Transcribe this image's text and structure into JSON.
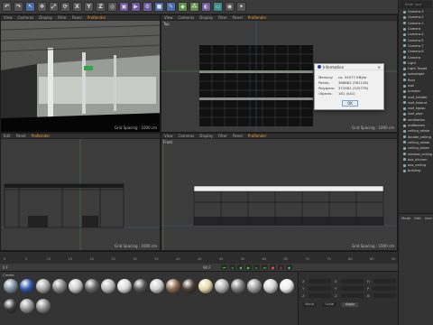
{
  "toolbar": {
    "icons": [
      "undo-icon",
      "redo-icon",
      "select-icon",
      "move-icon",
      "scale-icon",
      "rotate-icon",
      "x-axis",
      "y-axis",
      "z-axis",
      "world-icon",
      "render-view-icon",
      "render-icon",
      "render-settings-icon",
      "cube-icon",
      "pen-icon",
      "subdivide-icon",
      "array-icon",
      "deformer-icon",
      "floor-icon",
      "camera-icon",
      "light-icon"
    ],
    "axis_x": "X",
    "axis_y": "Y",
    "axis_z": "Z"
  },
  "viewports": {
    "menu": [
      "View",
      "Cameras",
      "Display",
      "Filter",
      "Panel"
    ],
    "active": "ProRender",
    "top_left": {
      "label": "",
      "grid": "Grid Spacing : 1000 cm"
    },
    "top_right": {
      "label": "Top",
      "grid": "Grid Spacing : 1000 cm"
    },
    "bottom_left": {
      "label": "Right",
      "grid": "Grid Spacing : 1000 cm"
    },
    "bottom_right": {
      "label": "Front",
      "grid": "Grid Spacing : 1000 cm"
    },
    "left_menu": [
      "Edit",
      "Panel"
    ]
  },
  "dialog": {
    "title": "Information",
    "rows": [
      {
        "key": "Memory:",
        "value": "ca. 54577 KByte"
      },
      {
        "key": "Points:",
        "value": "386862 (361128)"
      },
      {
        "key": "Polygons:",
        "value": "372581 (325776)"
      },
      {
        "key": "Objects:",
        "value": "161 (441)"
      }
    ],
    "ok": "OK"
  },
  "object_manager": {
    "header": "Enter your",
    "items": [
      "Camera.3",
      "Camera.2",
      "Camera.1",
      "Camera",
      "Camera.4",
      "Camera.5",
      "Camera.7",
      "Camera.6",
      "Camera",
      "Light",
      "Light Target",
      "uplowlight",
      "floor",
      "wall",
      "number",
      "roof_kritofel",
      "roof_kstand",
      "roof_kgosp",
      "roof_pipe",
      "ventilation",
      "roofbeams",
      "ceiling_rotate",
      "double_ceiling",
      "ceiling_rotate",
      "ceiling_tubes",
      "window_ceiling",
      "box_kitchen",
      "box_ceiling",
      "building"
    ]
  },
  "attributes": {
    "tabs": [
      "Mode",
      "Edit",
      "User"
    ]
  },
  "timeline": {
    "start": "0 F",
    "end": "90 F",
    "ticks": [
      "0",
      "5",
      "10",
      "15",
      "20",
      "25",
      "30",
      "35",
      "40",
      "45",
      "50",
      "55",
      "60",
      "65",
      "70",
      "75",
      "80",
      "85",
      "90"
    ],
    "current": "0 F"
  },
  "materials": {
    "menu": "Create",
    "names": [
      "",
      "",
      "",
      "",
      "",
      "",
      "",
      "",
      "",
      "",
      "",
      "",
      "",
      "",
      "",
      "",
      "",
      "",
      "",
      "",
      ""
    ],
    "colors": [
      "#7f8fa0",
      "#2e55a6",
      "#a9a9a9",
      "#888",
      "#c8c8c8",
      "#666",
      "#b9b9b9",
      "#d9d9d9",
      "#555",
      "#cfcfcf",
      "#8c6a4a",
      "#4a3d33",
      "#e3d6a8",
      "#b0b0b0",
      "#7b7b7b",
      "#9a9a9a",
      "#d0d0d0",
      "#eeeeee",
      "#3a3a3a",
      "#969696",
      "#8a8a8a"
    ]
  },
  "coordinates": {
    "rows": [
      {
        "a": "X",
        "b": "X",
        "c": "H"
      },
      {
        "a": "Y",
        "b": "Y",
        "c": "P"
      },
      {
        "a": "Z",
        "b": "Z",
        "c": "B"
      }
    ],
    "mode": "World",
    "scale": "Scale",
    "apply": "Apply"
  }
}
